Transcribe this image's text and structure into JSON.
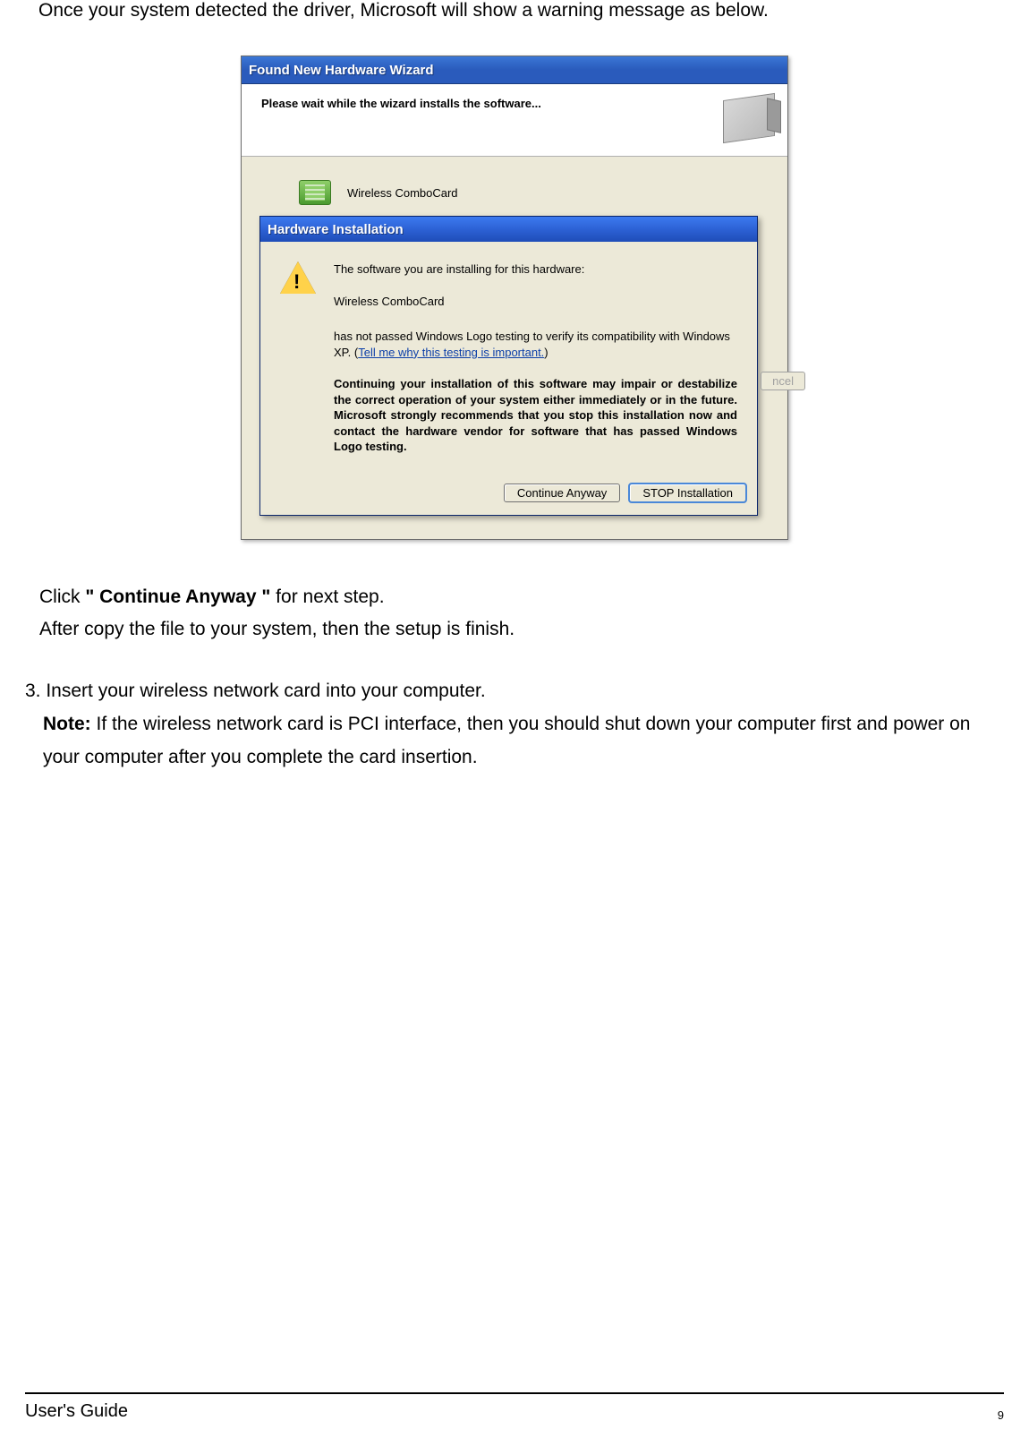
{
  "intro_text": "Once your system detected the driver, Microsoft will show a warning message as below.",
  "wizard": {
    "title": "Found New Hardware Wizard",
    "header_text": "Please wait while the wizard installs the software...",
    "device_name": "Wireless ComboCard"
  },
  "hw_dialog": {
    "title": "Hardware Installation",
    "line1": "The software you are installing for this hardware:",
    "device": "Wireless ComboCard",
    "line2_a": "has not passed Windows Logo testing to verify its compatibility with Windows XP. (",
    "link_text": "Tell me why this testing is important.",
    "line2_b": ")",
    "bold_block": "Continuing your installation of this software may impair or destabilize the correct operation of your system either immediately or in the future. Microsoft strongly recommends that you stop this installation now and contact the hardware vendor for software that has passed Windows Logo testing.",
    "btn_continue": "Continue Anyway",
    "btn_stop": "STOP Installation",
    "behind_cancel": "ncel"
  },
  "instructions": {
    "click_prefix": "Click ",
    "click_bold": "\" Continue Anyway \"",
    "click_suffix": " for next step.",
    "after_copy": "After copy the file to your system, then the setup is finish."
  },
  "step3": {
    "line1": "3. Insert your wireless network card into your computer.",
    "note_label": "Note:",
    "note_text": " If the wireless network card is PCI interface, then you should shut down your computer first and power on your computer after you complete the card insertion."
  },
  "footer": {
    "left": "User's Guide",
    "page": "9"
  }
}
